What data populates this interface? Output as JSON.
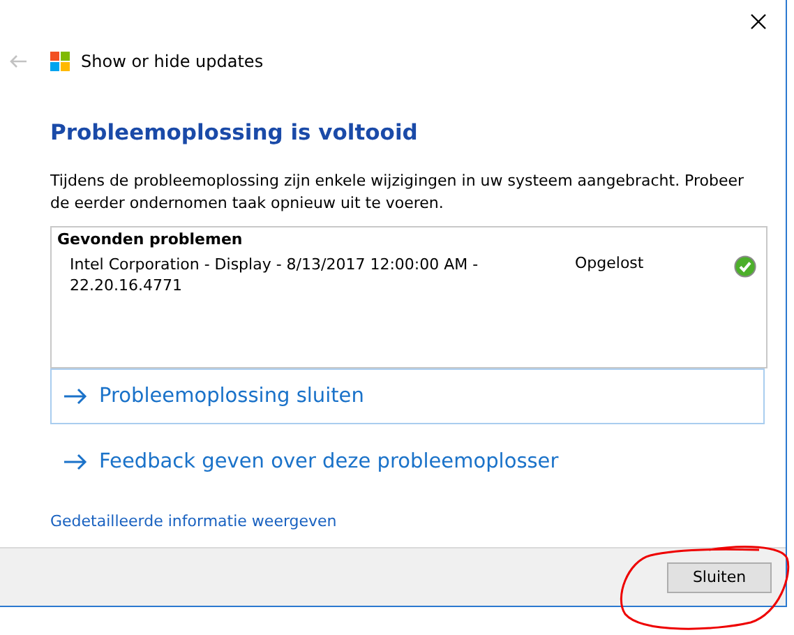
{
  "window": {
    "title": "Show or hide updates"
  },
  "heading": "Probleemoplossing is voltooid",
  "message": "Tijdens de probleemoplossing zijn enkele wijzigingen in uw systeem aangebracht. Probeer de eerder ondernomen taak opnieuw uit te voeren.",
  "problems": {
    "title": "Gevonden problemen",
    "items": [
      {
        "description": "Intel Corporation - Display - 8/13/2017 12:00:00 AM - 22.20.16.4771",
        "status": "Opgelost",
        "resolved": true
      }
    ]
  },
  "actions": [
    {
      "label": "Probleemoplossing sluiten",
      "selected": true
    },
    {
      "label": "Feedback geven over deze probleemoplosser",
      "selected": false
    }
  ],
  "details_link": "Gedetailleerde informatie weergeven",
  "buttons": [
    "Sluiten"
  ]
}
